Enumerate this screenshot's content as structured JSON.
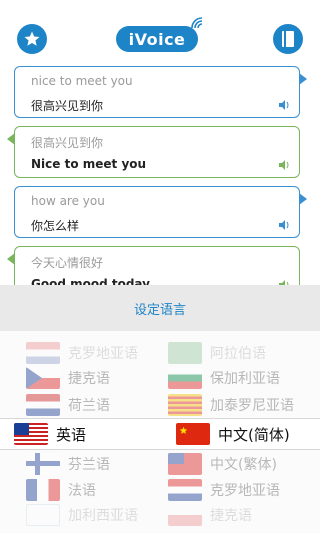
{
  "header": {
    "logo": "iVoice",
    "left_icon": "star-icon",
    "right_icon": "book-icon",
    "accent": "#1e84c8"
  },
  "messages": [
    {
      "source": "nice to meet you",
      "translation": "很高兴见到你",
      "side": "right",
      "color": "#3a8fd1"
    },
    {
      "source": "很高兴见到你",
      "translation": "Nice to meet you",
      "side": "left",
      "color": "#7ab55c"
    },
    {
      "source": "how are you",
      "translation": "你怎么样",
      "side": "right",
      "color": "#3a8fd1"
    },
    {
      "source": "今天心情很好",
      "translation": "Good mood today",
      "side": "left",
      "color": "#7ab55c"
    }
  ],
  "picker": {
    "title": "设定语言",
    "rows": [
      {
        "left": "克罗地亚语",
        "right": "阿拉伯语"
      },
      {
        "left": "捷克语",
        "right": "保加利亚语"
      },
      {
        "left": "荷兰语",
        "right": "加泰罗尼亚语"
      },
      {
        "left": "英语",
        "right": "中文(简体)"
      },
      {
        "left": "芬兰语",
        "right": "中文(繁体)"
      },
      {
        "left": "法语",
        "right": "克罗地亚语"
      },
      {
        "left": "加利西亚语",
        "right": "捷克语"
      }
    ]
  }
}
